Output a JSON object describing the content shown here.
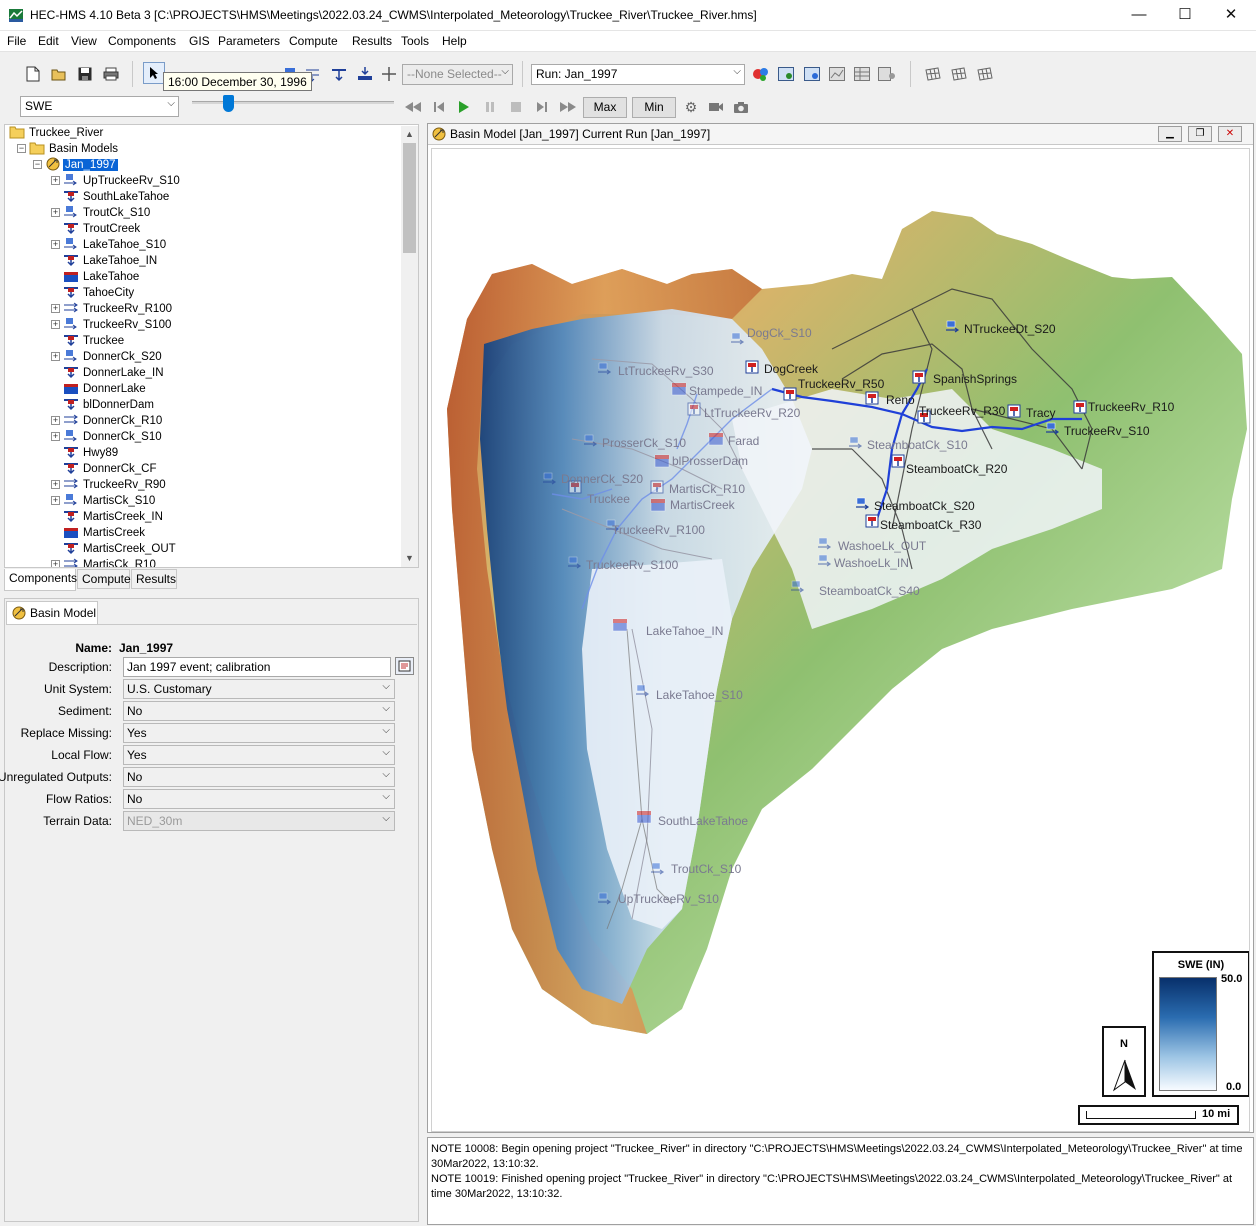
{
  "window": {
    "title": "HEC-HMS 4.10 Beta 3 [C:\\PROJECTS\\HMS\\Meetings\\2022.03.24_CWMS\\Interpolated_Meteorology\\Truckee_River\\Truckee_River.hms]",
    "minimize": "—",
    "maximize": "☐",
    "close": "✕"
  },
  "menu": [
    "File",
    "Edit",
    "View",
    "Components",
    "GIS",
    "Parameters",
    "Compute",
    "Results",
    "Tools",
    "Help"
  ],
  "toolbar": {
    "element_select": "--None Selected--",
    "run_select": "Run: Jan_1997",
    "tooltip": "16:00 December 30, 1996",
    "grid_select": "SWE",
    "max_label": "Max",
    "min_label": "Min"
  },
  "tree": {
    "root": "Truckee_River",
    "basin_models": "Basin Models",
    "selected_basin": "Jan_1997",
    "elements": [
      {
        "name": "UpTruckeeRv_S10",
        "type": "subbasin",
        "expand": true
      },
      {
        "name": "SouthLakeTahoe",
        "type": "junction",
        "expand": false
      },
      {
        "name": "TroutCk_S10",
        "type": "subbasin",
        "expand": true
      },
      {
        "name": "TroutCreek",
        "type": "junction",
        "expand": false
      },
      {
        "name": "LakeTahoe_S10",
        "type": "subbasin",
        "expand": true
      },
      {
        "name": "LakeTahoe_IN",
        "type": "junction",
        "expand": false
      },
      {
        "name": "LakeTahoe",
        "type": "reservoir",
        "expand": false
      },
      {
        "name": "TahoeCity",
        "type": "junction",
        "expand": false
      },
      {
        "name": "TruckeeRv_R100",
        "type": "reach",
        "expand": true
      },
      {
        "name": "TruckeeRv_S100",
        "type": "subbasin",
        "expand": true
      },
      {
        "name": "Truckee",
        "type": "junction",
        "expand": false
      },
      {
        "name": "DonnerCk_S20",
        "type": "subbasin",
        "expand": true
      },
      {
        "name": "DonnerLake_IN",
        "type": "junction",
        "expand": false
      },
      {
        "name": "DonnerLake",
        "type": "reservoir",
        "expand": false
      },
      {
        "name": "blDonnerDam",
        "type": "junction",
        "expand": false
      },
      {
        "name": "DonnerCk_R10",
        "type": "reach",
        "expand": true
      },
      {
        "name": "DonnerCk_S10",
        "type": "subbasin",
        "expand": true
      },
      {
        "name": "Hwy89",
        "type": "junction",
        "expand": false
      },
      {
        "name": "DonnerCk_CF",
        "type": "junction",
        "expand": false
      },
      {
        "name": "TruckeeRv_R90",
        "type": "reach",
        "expand": true
      },
      {
        "name": "MartisCk_S10",
        "type": "subbasin",
        "expand": true
      },
      {
        "name": "MartisCreek_IN",
        "type": "junction",
        "expand": false
      },
      {
        "name": "MartisCreek",
        "type": "reservoir",
        "expand": false
      },
      {
        "name": "MartisCreek_OUT",
        "type": "junction",
        "expand": false
      },
      {
        "name": "MartisCk_R10",
        "type": "reach",
        "expand": true
      }
    ]
  },
  "tree_tabs": [
    "Components",
    "Compute",
    "Results"
  ],
  "properties": {
    "tab": "Basin Model",
    "name_label": "Name:",
    "name_value": "Jan_1997",
    "fields": [
      {
        "label": "Description:",
        "value": "Jan 1997 event; calibration",
        "kind": "text"
      },
      {
        "label": "Unit System:",
        "value": "U.S. Customary",
        "kind": "select"
      },
      {
        "label": "Sediment:",
        "value": "No",
        "kind": "select"
      },
      {
        "label": "Replace Missing:",
        "value": "Yes",
        "kind": "select"
      },
      {
        "label": "Local Flow:",
        "value": "Yes",
        "kind": "select"
      },
      {
        "label": "Unregulated Outputs:",
        "value": "No",
        "kind": "select"
      },
      {
        "label": "Flow Ratios:",
        "value": "No",
        "kind": "select"
      },
      {
        "label": "Terrain Data:",
        "value": "NED_30m",
        "kind": "disabled"
      }
    ]
  },
  "map": {
    "title": "Basin Model [Jan_1997] Current Run [Jan_1997]",
    "labels": {
      "DogCreek": "DogCreek",
      "DogCk_S10": "DogCk_S10",
      "NTruckeeDt_S20": "NTruckeeDt_S20",
      "LtTruckeeRv_S30": "LtTruckeeRv_S30",
      "Stampede_IN": "Stampede_IN",
      "TruckeeRv_R50": "TruckeeRv_R50",
      "SpanishSprings": "SpanishSprings",
      "Reno": "Reno",
      "TruckeeRv_R30": "TruckeeRv_R30",
      "Tracy": "Tracy",
      "TruckeeRv_R10": "TruckeeRv_R10",
      "TruckeeRv_S10": "TruckeeRv_S10",
      "LtTruckeeRv_R20": "LtTruckeeRv_R20",
      "Farad": "Farad",
      "ProsserCk_S10": "ProsserCk_S10",
      "SteamboatCk_S10": "SteamboatCk_S10",
      "blProsserDam": "blProsserDam",
      "SteamboatCk_R20": "SteamboatCk_R20",
      "DonnerCk_S20": "DonnerCk_S20",
      "MartisCk_R10": "MartisCk_R10",
      "Truckee": "Truckee",
      "MartisCreek": "MartisCreek",
      "SteamboatCk_S20": "SteamboatCk_S20",
      "TruckeeRv_R100": "TruckeeRv_R100",
      "SteamboatCk_R30": "SteamboatCk_R30",
      "WashoeLk_OUT": "WashoeLk_OUT",
      "WashoeLk_IN": "WashoeLk_IN",
      "TruckeeRv_S100": "TruckeeRv_S100",
      "SteamboatCk_S40": "SteamboatCk_S40",
      "LakeTahoe_IN": "LakeTahoe_IN",
      "LakeTahoe_S10": "LakeTahoe_S10",
      "SouthLakeTahoe": "SouthLakeTahoe",
      "TroutCk_S10": "TroutCk_S10",
      "UpTruckeeRv_S10": "UpTruckeeRv_S10"
    },
    "legend": {
      "title": "SWE (IN)",
      "max": "50.0",
      "min": "0.0",
      "color_high": "#08306b",
      "color_low": "#f7fbff"
    },
    "north": "N",
    "scale": "10 mi"
  },
  "log": {
    "line1": "NOTE 10008:  Begin opening project \"Truckee_River\" in directory \"C:\\PROJECTS\\HMS\\Meetings\\2022.03.24_CWMS\\Interpolated_Meteorology\\Truckee_River\" at time 30Mar2022, 13:10:32.",
    "line2": "NOTE 10019:  Finished opening project \"Truckee_River\" in directory \"C:\\PROJECTS\\HMS\\Meetings\\2022.03.24_CWMS\\Interpolated_Meteorology\\Truckee_River\" at time 30Mar2022, 13:10:32."
  }
}
